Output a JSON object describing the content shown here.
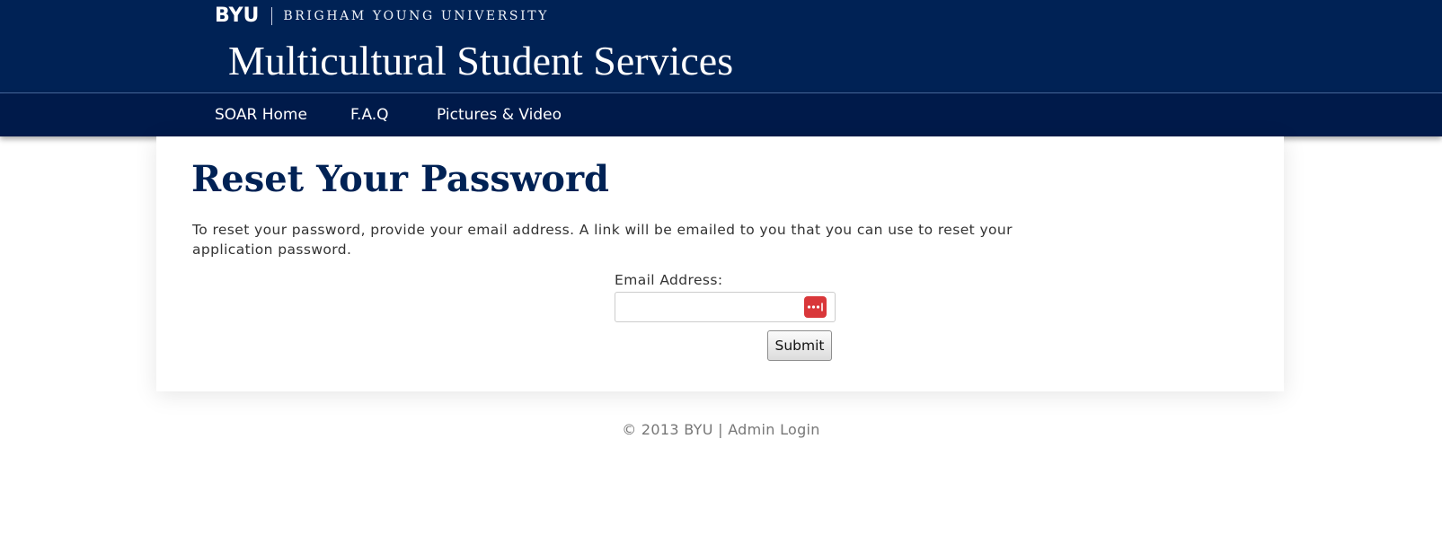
{
  "header": {
    "logo_text": "BYU",
    "university_name": "BRIGHAM YOUNG UNIVERSITY",
    "site_title": "Multicultural Student Services",
    "background_color": "#002255"
  },
  "nav": {
    "items": [
      {
        "label": "SOAR Home"
      },
      {
        "label": "F.A.Q"
      },
      {
        "label": "Pictures & Video"
      }
    ],
    "background_color": "#001a4a"
  },
  "main": {
    "title": "Reset Your Password",
    "instructions": "To reset your password, provide your email address. A link will be emailed to you that you can use to reset your application password.",
    "email_label": "Email Address:",
    "email_value": "",
    "email_placeholder": "",
    "password_manager_icon": "password-manager-icon",
    "password_manager_color": "#d9373a",
    "submit_label": "Submit"
  },
  "footer": {
    "copyright": "© 2013 BYU",
    "separator": "|",
    "admin_link": "Admin Login"
  }
}
